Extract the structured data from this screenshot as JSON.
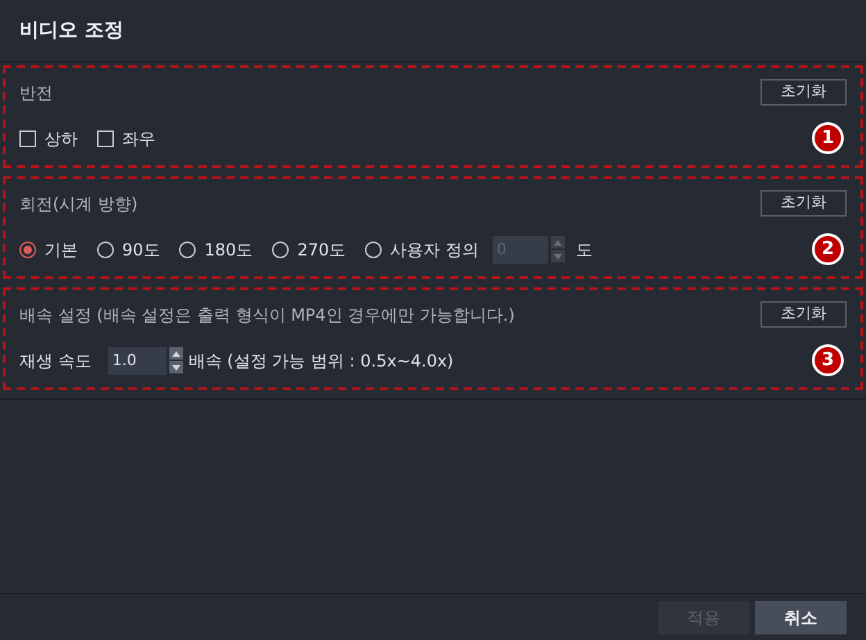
{
  "window": {
    "title": "비디오 조정"
  },
  "sections": [
    {
      "kind": "flip",
      "title": "반전",
      "reset": "초기화",
      "badge": "1",
      "options": [
        {
          "label": "상하",
          "checked": false
        },
        {
          "label": "좌우",
          "checked": false
        }
      ]
    },
    {
      "kind": "rotate",
      "title": "회전(시계 방향)",
      "reset": "초기화",
      "badge": "2",
      "options": [
        {
          "label": "기본",
          "selected": true
        },
        {
          "label": "90도",
          "selected": false
        },
        {
          "label": "180도",
          "selected": false
        },
        {
          "label": "270도",
          "selected": false
        },
        {
          "label": "사용자 정의",
          "selected": false
        }
      ],
      "custom": {
        "value": "0",
        "disabled": true,
        "unit": "도"
      }
    },
    {
      "kind": "speed",
      "title": "배속 설정 (배속 설정은 출력 형식이 MP4인 경우에만 가능합니다.)",
      "reset": "초기화",
      "badge": "3",
      "label": "재생 속도",
      "value": "1.0",
      "suffix": "배속 (설정 가능 범위 : 0.5x~4.0x)"
    }
  ],
  "buttons": [
    {
      "label": "적용",
      "disabled": true
    },
    {
      "label": "취소",
      "disabled": false
    }
  ]
}
